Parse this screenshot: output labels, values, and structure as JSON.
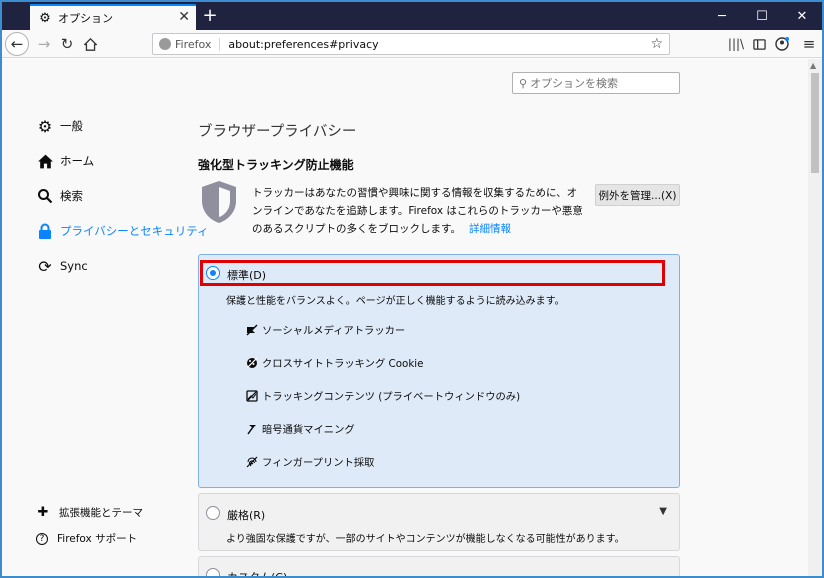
{
  "window": {
    "tab_title": "オプション",
    "tab_close": "✕",
    "new_tab": "+",
    "controls": {
      "minimize": "─",
      "maximize": "☐",
      "close": "✕"
    }
  },
  "navbar": {
    "identity_label": "Firefox",
    "url": "about:preferences#privacy"
  },
  "search": {
    "placeholder": "オプションを検索"
  },
  "sidebar": {
    "items": [
      {
        "label": "一般",
        "icon": "gear-icon"
      },
      {
        "label": "ホーム",
        "icon": "home-icon"
      },
      {
        "label": "検索",
        "icon": "search-icon"
      },
      {
        "label": "プライバシーとセキュリティ",
        "icon": "lock-icon",
        "active": true
      },
      {
        "label": "Sync",
        "icon": "sync-icon"
      }
    ],
    "footer": [
      {
        "label": "拡張機能とテーマ",
        "icon": "puzzle-icon"
      },
      {
        "label": "Firefox サポート",
        "icon": "help-icon"
      }
    ]
  },
  "main": {
    "heading": "ブラウザープライバシー",
    "subheading": "強化型トラッキング防止機能",
    "description": "トラッカーはあなたの習慣や興味に関する情報を収集するために、オンラインであなたを追跡します。Firefox はこれらのトラッカーや悪意のあるスクリプトの多くをブロックします。",
    "learn_more": "詳細情報",
    "exceptions_button": "例外を管理...(X)",
    "options": [
      {
        "label": "標準(D)",
        "selected": true,
        "description": "保護と性能をバランスよく。ページが正しく機能するように読み込みます。",
        "features": [
          {
            "label": "ソーシャルメディアトラッカー",
            "icon": "social-tracker-icon"
          },
          {
            "label": "クロスサイトトラッキング Cookie",
            "icon": "cookie-icon"
          },
          {
            "label": "トラッキングコンテンツ (プライベートウィンドウのみ)",
            "icon": "tracking-content-icon"
          },
          {
            "label": "暗号通貨マイニング",
            "icon": "cryptominer-icon"
          },
          {
            "label": "フィンガープリント採取",
            "icon": "fingerprint-icon"
          }
        ]
      },
      {
        "label": "厳格(R)",
        "selected": false,
        "description": "より強固な保護ですが、一部のサイトやコンテンツが機能しなくなる可能性があります。"
      },
      {
        "label": "カスタム(C)",
        "selected": false
      }
    ]
  },
  "colors": {
    "accent": "#0a84ff",
    "tabstrip": "#202340",
    "highlight": "#e00000",
    "selected_card": "#deeaf8"
  }
}
